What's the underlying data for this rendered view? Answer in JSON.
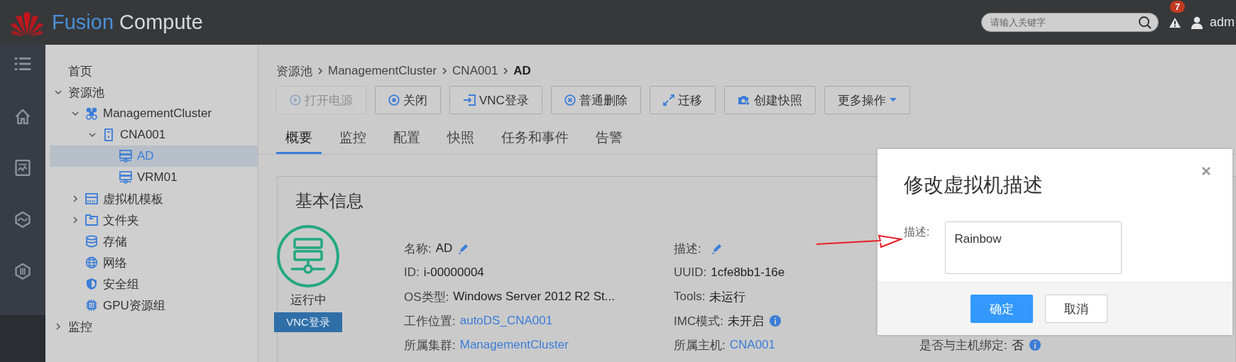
{
  "header": {
    "brand_part_1": "Fusion",
    "brand_part_2": "Compute",
    "search": {
      "placeholder": "请输入关键字"
    },
    "alert_count": "7",
    "user": "adm"
  },
  "tree": [
    {
      "label": "首页",
      "selected": false
    },
    {
      "label": "资源池",
      "expanded": true,
      "selected": false,
      "children": [
        {
          "label": "ManagementCluster",
          "kind": "cluster",
          "expanded": true,
          "selected": false,
          "children": [
            {
              "label": "CNA001",
              "kind": "host",
              "expanded": true,
              "selected": false,
              "children": [
                {
                  "label": "AD",
                  "kind": "vm",
                  "selected": true
                },
                {
                  "label": "VRM01",
                  "kind": "vm",
                  "selected": false
                }
              ]
            }
          ]
        },
        {
          "label": "虚拟机模板",
          "kind": "template",
          "expanded": false,
          "selected": false
        },
        {
          "label": "文件夹",
          "kind": "folder",
          "expanded": false,
          "selected": false
        },
        {
          "label": "存储",
          "kind": "storage",
          "selected": false
        },
        {
          "label": "网络",
          "kind": "network",
          "selected": false
        },
        {
          "label": "安全组",
          "kind": "security",
          "selected": false
        },
        {
          "label": "GPU资源组",
          "kind": "gpu",
          "selected": false
        }
      ]
    },
    {
      "label": "监控",
      "expanded": false,
      "selected": false
    }
  ],
  "breadcrumb": [
    {
      "label": "资源池",
      "current": false
    },
    {
      "label": "ManagementCluster",
      "current": false
    },
    {
      "label": "CNA001",
      "current": false
    },
    {
      "label": "AD",
      "current": true
    }
  ],
  "toolbar": [
    {
      "label": "打开电源",
      "kind": "power",
      "disabled": true
    },
    {
      "label": "关闭",
      "kind": "stop",
      "disabled": false
    },
    {
      "label": "VNC登录",
      "kind": "login",
      "disabled": false
    },
    {
      "label": "普通删除",
      "kind": "delete",
      "disabled": false
    },
    {
      "label": "迁移",
      "kind": "migrate",
      "disabled": false
    },
    {
      "label": "创建快照",
      "kind": "snapshot",
      "disabled": false
    },
    {
      "label": "更多操作",
      "kind": "dropdown",
      "disabled": false
    }
  ],
  "tabs": [
    {
      "label": "概要",
      "selected": true
    },
    {
      "label": "监控",
      "selected": false
    },
    {
      "label": "配置",
      "selected": false
    },
    {
      "label": "快照",
      "selected": false
    },
    {
      "label": "任务和事件",
      "selected": false
    },
    {
      "label": "告警",
      "selected": false
    }
  ],
  "basic_info": {
    "title": "基本信息",
    "status": "运行中",
    "vnc_button": "VNC登录",
    "columns": [
      [
        {
          "label": "名称:",
          "value": "AD",
          "kind": "editable"
        },
        {
          "label": "ID:",
          "value": "i-00000004",
          "kind": "plain"
        },
        {
          "label": "OS类型:",
          "value": "Windows Server 2012 R2 St...",
          "kind": "plain"
        },
        {
          "label": "工作位置:",
          "value": "autoDS_CNA001",
          "kind": "link"
        },
        {
          "label": "所属集群:",
          "value": "ManagementCluster",
          "kind": "link"
        }
      ],
      [
        {
          "label": "描述:",
          "kind": "editable"
        },
        {
          "label": "UUID:",
          "value": "1cfe8bb1-16e",
          "kind": "plain"
        },
        {
          "label": "Tools:",
          "value": "未运行",
          "kind": "plain"
        },
        {
          "label": "IMC模式:",
          "value": "未开启",
          "kind": "info"
        },
        {
          "label": "所属主机:",
          "value": "CNA001",
          "kind": "link"
        }
      ],
      [
        {
          "label": "是否与主机绑定:",
          "value": "否",
          "kind": "info"
        }
      ]
    ]
  },
  "dialog": {
    "title": "修改虚拟机描述",
    "field_label": "描述:",
    "value": "Rainbow",
    "buttons": [
      {
        "label": "确定",
        "primary": true
      },
      {
        "label": "取消",
        "primary": false
      }
    ]
  }
}
